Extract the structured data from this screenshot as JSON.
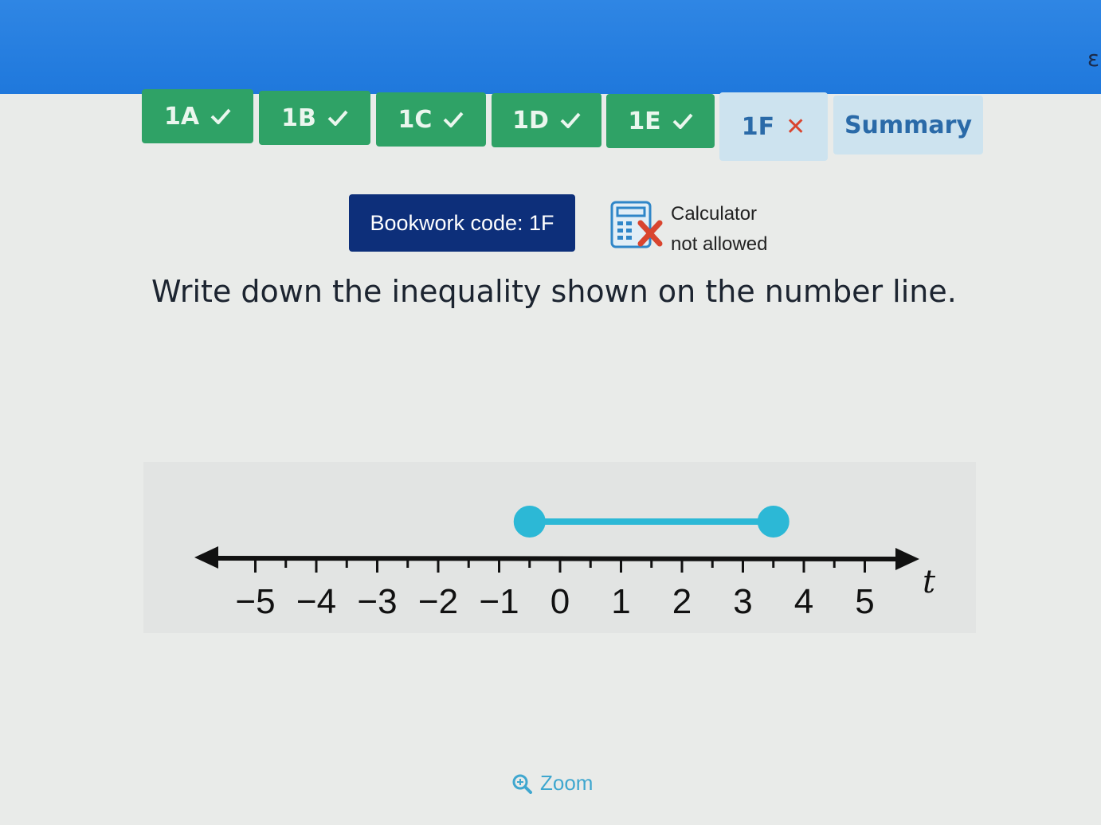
{
  "tabs": [
    {
      "label": "1A",
      "status": "correct"
    },
    {
      "label": "1B",
      "status": "correct"
    },
    {
      "label": "1C",
      "status": "correct"
    },
    {
      "label": "1D",
      "status": "correct"
    },
    {
      "label": "1E",
      "status": "correct"
    },
    {
      "label": "1F",
      "status": "incorrect"
    }
  ],
  "summary_label": "Summary",
  "bookwork_code": "Bookwork code: 1F",
  "calculator": {
    "line1": "Calculator",
    "line2": "not allowed"
  },
  "question": "Write down the inequality shown on the number line.",
  "number_line": {
    "variable": "t",
    "tick_labels": [
      "-5",
      "-4",
      "-3",
      "-2",
      "-1",
      "0",
      "1",
      "2",
      "3",
      "4",
      "5"
    ],
    "interval_start": -0.5,
    "interval_end": 3.5,
    "start_closed": true,
    "end_closed": true,
    "color": "#2cb8d6"
  },
  "zoom_label": "Zoom",
  "colors": {
    "header": "#1f78dc",
    "tab_done": "#2fa266",
    "tab_current": "#cde3ef",
    "bookwork": "#0d2f7a",
    "incorrect": "#d9452f",
    "accent": "#2cb8d6"
  }
}
